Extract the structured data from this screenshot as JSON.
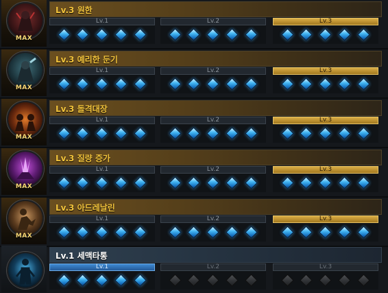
{
  "icons": {
    "gem_filled": "blue-diamond-icon",
    "gem_empty": "gray-diamond-icon"
  },
  "colors": {
    "gold_title": "#f2c33b",
    "gold_bar": "#b88b2a",
    "blue_bar": "#2f6fb4",
    "gem_blue": "#44b7f4",
    "background": "#15181c"
  },
  "skills": [
    {
      "title": "Lv.3 원한",
      "badge": "MAX",
      "icon": "grudge-skill-icon",
      "levels": [
        {
          "label": "Lv.1",
          "state": "done",
          "gems": 5
        },
        {
          "label": "Lv.2",
          "state": "done",
          "gems": 5
        },
        {
          "label": "Lv.3",
          "state": "current",
          "gems": 5
        }
      ]
    },
    {
      "title": "Lv.3 예리한 둔기",
      "badge": "MAX",
      "icon": "keen-blunt-weapon-skill-icon",
      "levels": [
        {
          "label": "Lv.1",
          "state": "done",
          "gems": 5
        },
        {
          "label": "Lv.2",
          "state": "done",
          "gems": 5
        },
        {
          "label": "Lv.3",
          "state": "current",
          "gems": 5
        }
      ]
    },
    {
      "title": "Lv.3 돌격대장",
      "badge": "MAX",
      "icon": "raid-captain-skill-icon",
      "levels": [
        {
          "label": "Lv.1",
          "state": "done",
          "gems": 5
        },
        {
          "label": "Lv.2",
          "state": "done",
          "gems": 5
        },
        {
          "label": "Lv.3",
          "state": "current",
          "gems": 5
        }
      ]
    },
    {
      "title": "Lv.3 질량 증가",
      "badge": "MAX",
      "icon": "mass-increase-skill-icon",
      "levels": [
        {
          "label": "Lv.1",
          "state": "done",
          "gems": 5
        },
        {
          "label": "Lv.2",
          "state": "done",
          "gems": 5
        },
        {
          "label": "Lv.3",
          "state": "current",
          "gems": 5
        }
      ]
    },
    {
      "title": "Lv.3 아드레날린",
      "badge": "MAX",
      "icon": "adrenaline-skill-icon",
      "levels": [
        {
          "label": "Lv.1",
          "state": "done",
          "gems": 5
        },
        {
          "label": "Lv.2",
          "state": "done",
          "gems": 5
        },
        {
          "label": "Lv.3",
          "state": "current",
          "gems": 5
        }
      ]
    },
    {
      "title": "Lv.1 세맥타통",
      "badge": "",
      "icon": "meridian-skill-icon",
      "levels": [
        {
          "label": "Lv.1",
          "state": "active",
          "gems": 5
        },
        {
          "label": "Lv.2",
          "state": "locked",
          "gems": 0
        },
        {
          "label": "Lv.3",
          "state": "locked",
          "gems": 0
        }
      ]
    }
  ]
}
